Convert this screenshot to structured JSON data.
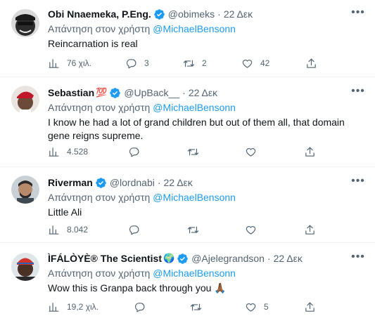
{
  "tweets": [
    {
      "name": "Obi Nnaemeka, P.Eng.",
      "handle": "@obimeks",
      "time": "22 Δεκ",
      "reply_prefix": "Απάντηση στον χρήστη",
      "reply_to": "@MichaelBensonn",
      "text": "Reincarnation is real",
      "views": "76 χιλ.",
      "replies": "3",
      "retweets": "2",
      "likes": "42"
    },
    {
      "name": "Sebastian",
      "name_emoji": "💯",
      "handle": "@UpBack__",
      "time": "22 Δεκ",
      "reply_prefix": "Απάντηση στον χρήστη",
      "reply_to": "@MichaelBensonn",
      "text": "I know he had a lot of grand children but out of them all, that domain gene reigns supreme.",
      "views": "4.528",
      "replies": "",
      "retweets": "",
      "likes": ""
    },
    {
      "name": "Riverman",
      "handle": "@lordnabi",
      "time": "22 Δεκ",
      "reply_prefix": "Απάντηση στον χρήστη",
      "reply_to": "@MichaelBensonn",
      "text": "Little Ali",
      "views": "8.042",
      "replies": "",
      "retweets": "",
      "likes": ""
    },
    {
      "name": "ÌFÁLÒYÈ® The Scientist",
      "name_emoji": "🌍",
      "handle": "@Ajelegrandson",
      "time": "22 Δεκ",
      "reply_prefix": "Απάντηση στον χρήστη",
      "reply_to": "@MichaelBensonn",
      "text": "Wow this is Granpa back through you 🙏🏾",
      "views": "19,2 χιλ.",
      "replies": "",
      "retweets": "",
      "likes": "5"
    }
  ],
  "separator_dot": "·",
  "colors": {
    "accent": "#1d9bf0",
    "muted": "#536471",
    "text": "#0f1419"
  },
  "icons": [
    "verified-badge-icon",
    "more-icon",
    "views-icon",
    "reply-icon",
    "retweet-icon",
    "like-icon",
    "share-icon"
  ]
}
